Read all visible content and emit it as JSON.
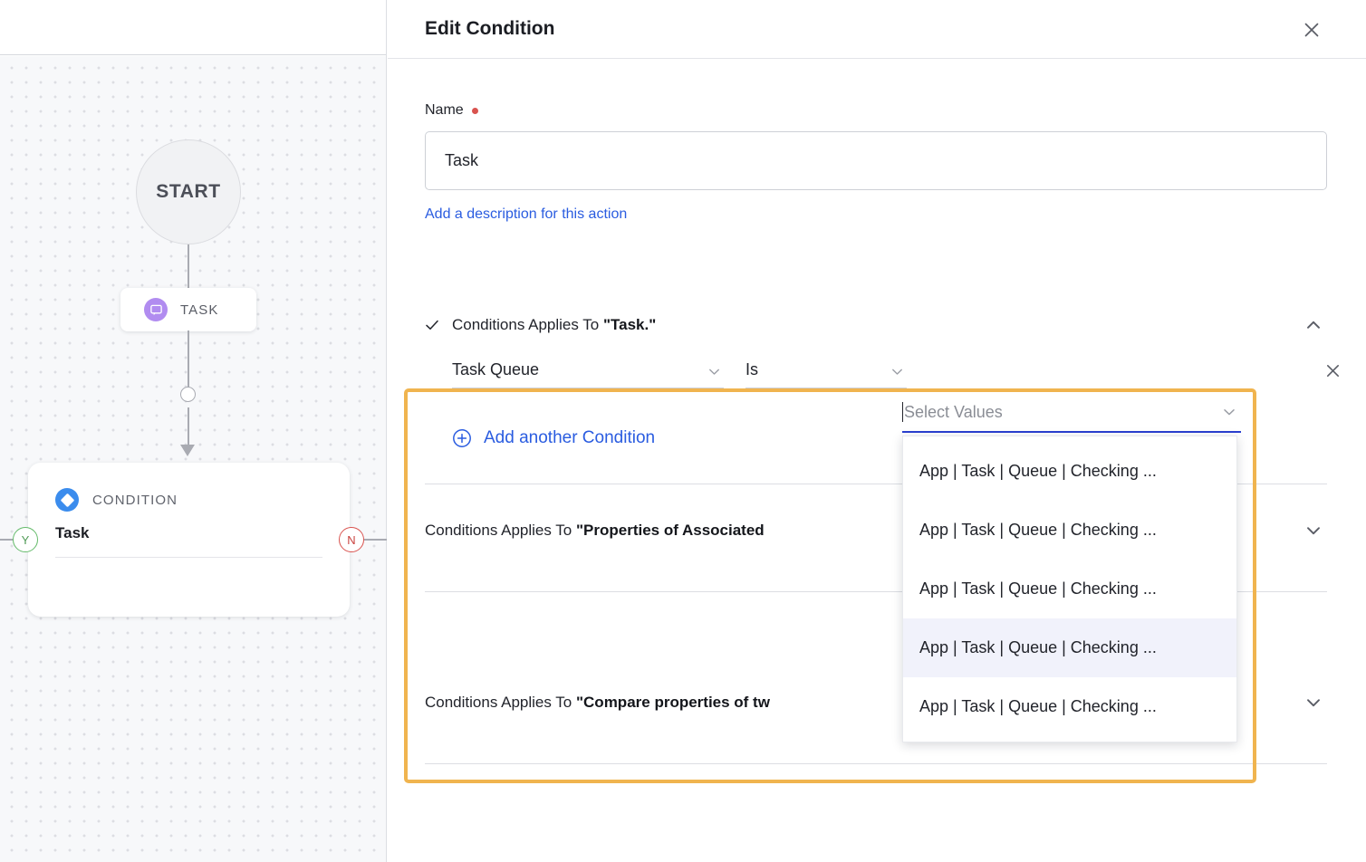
{
  "flow": {
    "start_label": "START",
    "task_node": {
      "label": "TASK",
      "icon": "speech-bubble-icon"
    },
    "condition_node": {
      "type_label": "CONDITION",
      "name": "Task",
      "icon": "diamond-icon",
      "yes_branch": "Y",
      "no_branch": "N"
    }
  },
  "panel": {
    "title": "Edit Condition",
    "close_icon": "close-icon"
  },
  "form": {
    "name_label": "Name",
    "name_value": "Task",
    "name_placeholder": "Name",
    "description_link": "Add a description for this action"
  },
  "sections": [
    {
      "prefix": "Conditions Applies To ",
      "quoted": "\"Task.\"",
      "expanded": true,
      "check_icon": "check-icon",
      "chevron": "chevron-up-icon"
    },
    {
      "prefix": "Conditions Applies To ",
      "quoted": "\"Properties of Associated",
      "expanded": false,
      "chevron": "chevron-down-icon"
    },
    {
      "prefix": "Conditions Applies To ",
      "quoted": "\"Compare properties of tw",
      "expanded": false,
      "chevron": "chevron-down-icon"
    }
  ],
  "condition_row": {
    "property_value": "Task Queue",
    "operator_value": "Is",
    "values_placeholder": "Select Values",
    "remove_icon": "close-icon",
    "property_caret": "chevron-down-icon",
    "operator_caret": "chevron-down-icon",
    "values_caret": "chevron-down-icon"
  },
  "values_dropdown": {
    "options": [
      {
        "label": "App | Task | Queue | Checking ...",
        "active": false
      },
      {
        "label": "App | Task | Queue | Checking ...",
        "active": false
      },
      {
        "label": "App | Task | Queue | Checking ...",
        "active": false
      },
      {
        "label": "App | Task | Queue | Checking ...",
        "active": true
      },
      {
        "label": "App | Task | Queue | Checking ...",
        "active": false
      }
    ]
  },
  "add_condition": {
    "label": "Add another Condition",
    "icon": "plus-circle-icon"
  },
  "colors": {
    "highlight_border": "#f0b44f",
    "link": "#2a5ce0",
    "condition_icon": "#3b8ced",
    "task_icon": "#b18cf0",
    "required_dot": "#d9534f",
    "yes_badge": "#64bb6a",
    "no_badge": "#d9534f",
    "focus_underline": "#2a3fd0",
    "option_active_bg": "#f1f2fb"
  }
}
